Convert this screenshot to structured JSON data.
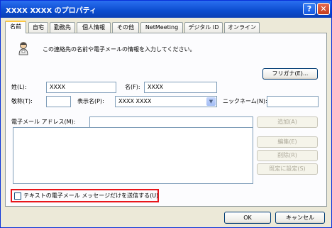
{
  "window": {
    "title": "XXXX XXXX のプロパティ",
    "help_glyph": "?",
    "close_glyph": "✕"
  },
  "tabs": [
    "名前",
    "自宅",
    "勤務先",
    "個人情報",
    "その他",
    "NetMeeting",
    "デジタル ID",
    "オンライン"
  ],
  "intro_text": "この連絡先の名前や電子メールの情報を入力してください。",
  "name_fields": {
    "last_label": "姓(L):",
    "last_value": "XXXX",
    "first_label": "名(F):",
    "first_value": "XXXX",
    "furigana_button": "フリガナ(E)...",
    "title_label": "敬称(T):",
    "title_value": "",
    "display_label": "表示名(P):",
    "display_value": "XXXX XXXX",
    "nickname_label": "ニックネーム(N):",
    "nickname_value": ""
  },
  "email": {
    "label": "電子メール アドレス(M):",
    "value": "",
    "add_button": "追加(A)",
    "edit_button": "編集(E)",
    "delete_button": "削除(R)",
    "default_button": "既定に設定(S)"
  },
  "plain_text_option": {
    "label": "テキストの電子メール メッセージだけを送信する(U)",
    "checked": false
  },
  "footer": {
    "ok_button": "OK",
    "cancel_button": "キャンセル"
  },
  "colors": {
    "titlebar": "#0b4ccf",
    "highlight_border": "#e8161b",
    "dialog_bg": "#ece9d8"
  }
}
